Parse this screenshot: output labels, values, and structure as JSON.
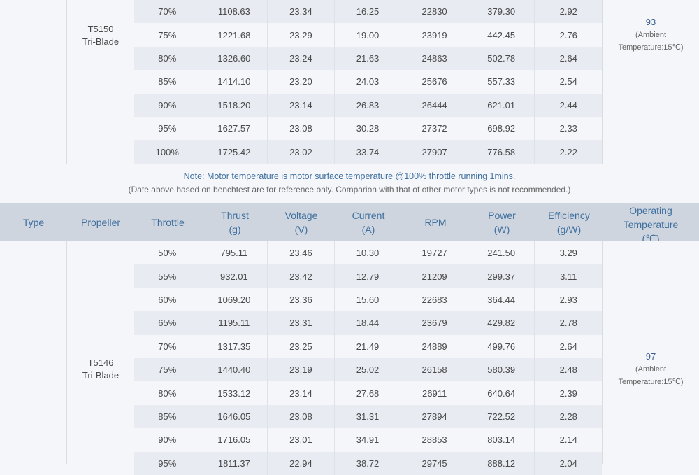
{
  "table1": {
    "propeller": [
      "T5150",
      "Tri-Blade"
    ],
    "temperature": {
      "value": "93",
      "sub1": "(Ambient",
      "sub2": "Temperature:15℃)"
    },
    "rows": [
      [
        "70%",
        "1108.63",
        "23.34",
        "16.25",
        "22830",
        "379.30",
        "2.92"
      ],
      [
        "75%",
        "1221.68",
        "23.29",
        "19.00",
        "23919",
        "442.45",
        "2.76"
      ],
      [
        "80%",
        "1326.60",
        "23.24",
        "21.63",
        "24863",
        "502.78",
        "2.64"
      ],
      [
        "85%",
        "1414.10",
        "23.20",
        "24.03",
        "25676",
        "557.33",
        "2.54"
      ],
      [
        "90%",
        "1518.20",
        "23.14",
        "26.83",
        "26444",
        "621.01",
        "2.44"
      ],
      [
        "95%",
        "1627.57",
        "23.08",
        "30.28",
        "27372",
        "698.92",
        "2.33"
      ],
      [
        "100%",
        "1725.42",
        "23.02",
        "33.74",
        "27907",
        "776.58",
        "2.22"
      ]
    ]
  },
  "note": {
    "line1": "Note: Motor temperature is motor surface temperature @100% throttle running 1mins.",
    "line2": "(Date above based on benchtest are for reference only. Comparion with that of other motor types is not recommended.)"
  },
  "header": {
    "type": "Type",
    "propeller": "Propeller",
    "throttle": "Throttle",
    "thrust": [
      "Thrust",
      "(g)"
    ],
    "voltage": [
      "Voltage",
      "(V)"
    ],
    "current": [
      "Current",
      "(A)"
    ],
    "rpm": "RPM",
    "power": [
      "Power",
      "(W)"
    ],
    "efficiency": [
      "Efficiency",
      "(g/W)"
    ],
    "temp": [
      "Operating",
      "Temperature",
      "(℃)"
    ]
  },
  "table2": {
    "propeller": [
      "T5146",
      "Tri-Blade"
    ],
    "temperature": {
      "value": "97",
      "sub1": "(Ambient",
      "sub2": "Temperature:15℃)"
    },
    "rows": [
      [
        "50%",
        "795.11",
        "23.46",
        "10.30",
        "19727",
        "241.50",
        "3.29"
      ],
      [
        "55%",
        "932.01",
        "23.42",
        "12.79",
        "21209",
        "299.37",
        "3.11"
      ],
      [
        "60%",
        "1069.20",
        "23.36",
        "15.60",
        "22683",
        "364.44",
        "2.93"
      ],
      [
        "65%",
        "1195.11",
        "23.31",
        "18.44",
        "23679",
        "429.82",
        "2.78"
      ],
      [
        "70%",
        "1317.35",
        "23.25",
        "21.49",
        "24889",
        "499.76",
        "2.64"
      ],
      [
        "75%",
        "1440.40",
        "23.19",
        "25.02",
        "26158",
        "580.39",
        "2.48"
      ],
      [
        "80%",
        "1533.12",
        "23.14",
        "27.68",
        "26911",
        "640.64",
        "2.39"
      ],
      [
        "85%",
        "1646.05",
        "23.08",
        "31.31",
        "27894",
        "722.52",
        "2.28"
      ],
      [
        "90%",
        "1716.05",
        "23.01",
        "34.91",
        "28853",
        "803.14",
        "2.14"
      ],
      [
        "95%",
        "1811.37",
        "22.94",
        "38.72",
        "29745",
        "888.12",
        "2.04"
      ]
    ]
  }
}
